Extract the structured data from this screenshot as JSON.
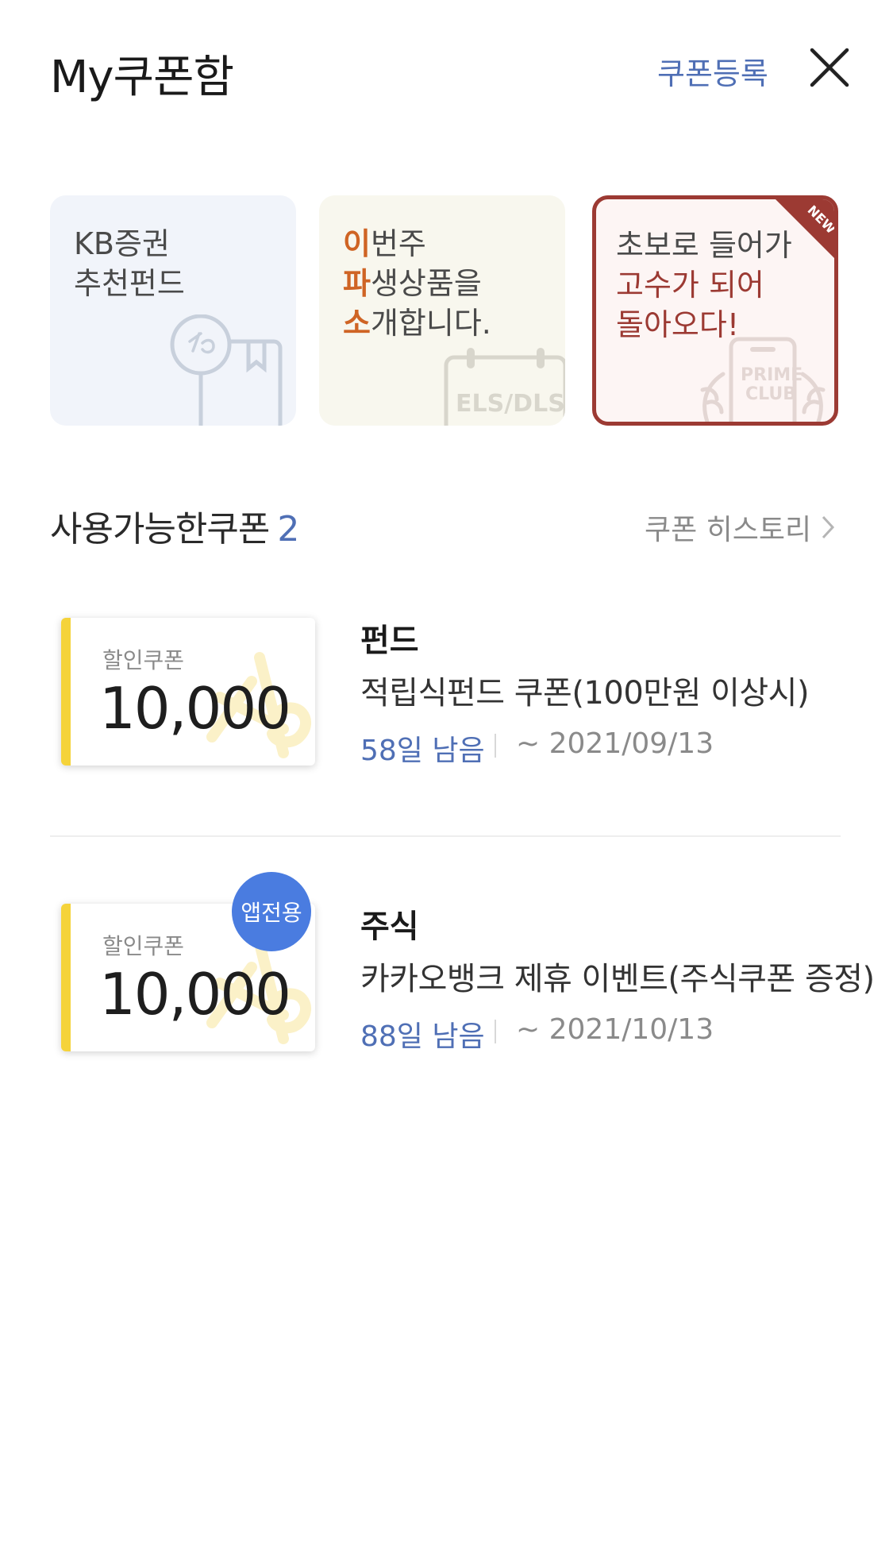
{
  "header": {
    "title": "My쿠폰함",
    "register_label": "쿠폰등록",
    "close_icon": "close-icon"
  },
  "banners": [
    {
      "lines": [
        "KB증권",
        "추천펀드"
      ],
      "icon": "kb-fund-icon"
    },
    {
      "lines": [
        {
          "accent": "이",
          "rest": "번주"
        },
        {
          "accent": "파",
          "rest": "생상품을"
        },
        {
          "accent": "소",
          "rest": "개합니다."
        }
      ],
      "illust_text": "ELS/DLS",
      "icon": "calendar-icon"
    },
    {
      "lines": [
        "초보로 들어가",
        "고수가 되어",
        "돌아오다!"
      ],
      "badge": "NEW",
      "illust_text": [
        "PRIME",
        "CLUB"
      ],
      "icon": "phone-icon",
      "accent_color": "#9c3a33"
    }
  ],
  "section": {
    "title": "사용가능한쿠폰",
    "count": "2",
    "history_label": "쿠폰 히스토리"
  },
  "coupons": [
    {
      "label": "할인쿠폰",
      "amount": "10,000",
      "category": "펀드",
      "description": "적립식펀드 쿠폰(100만원 이상시)",
      "days_left": "58일 남음",
      "expiry": "~ 2021/09/13",
      "badge": ""
    },
    {
      "label": "할인쿠폰",
      "amount": "10,000",
      "category": "주식",
      "description": "카카오뱅크 제휴 이벤트(주식쿠폰 증정)",
      "days_left": "88일 남음",
      "expiry": "~ 2021/10/13",
      "badge": "앱전용"
    }
  ],
  "colors": {
    "accent_blue": "#4f6fb5",
    "ticket_bar": "#f5d33a",
    "badge_blue": "#4a7ce0",
    "orange": "#cf6424",
    "maroon": "#9c3a33"
  }
}
